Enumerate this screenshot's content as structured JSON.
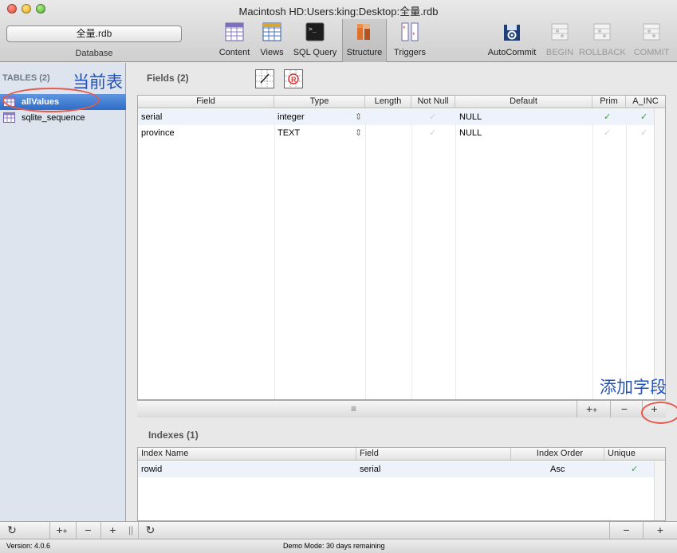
{
  "window": {
    "title": "Macintosh HD:Users:king:Desktop:全量.rdb"
  },
  "toolbar": {
    "database_value": "全量.rdb",
    "database_label": "Database",
    "buttons": [
      {
        "label": "Content",
        "icon": "content-icon"
      },
      {
        "label": "Views",
        "icon": "views-icon"
      },
      {
        "label": "SQL Query",
        "icon": "terminal-icon"
      },
      {
        "label": "Structure",
        "icon": "structure-icon",
        "selected": true
      },
      {
        "label": "Triggers",
        "icon": "triggers-icon"
      },
      {
        "label": "AutoCommit",
        "icon": "autocommit-icon"
      },
      {
        "label": "BEGIN",
        "icon": "begin-icon",
        "disabled": true
      },
      {
        "label": "ROLLBACK",
        "icon": "rollback-icon",
        "disabled": true
      },
      {
        "label": "COMMIT",
        "icon": "commit-icon",
        "disabled": true
      }
    ]
  },
  "sidebar": {
    "header": "TABLES (2)",
    "tables": [
      {
        "name": "allValues",
        "selected": true
      },
      {
        "name": "sqlite_sequence",
        "selected": false
      }
    ],
    "annotation": "当前表"
  },
  "fields": {
    "title": "Fields (2)",
    "columns": [
      "Field",
      "Type",
      "Length",
      "Not Null",
      "Default",
      "Prim",
      "A_INC"
    ],
    "rows": [
      {
        "field": "serial",
        "type": "integer",
        "length": "",
        "default": "NULL",
        "not_null": false,
        "prim": true,
        "ainc": true
      },
      {
        "field": "province",
        "type": "TEXT",
        "length": "",
        "default": "NULL",
        "not_null": false,
        "prim": false,
        "ainc": false
      }
    ],
    "add_annotation": "添加字段",
    "buttons": {
      "add": "+",
      "remove": "−",
      "duplicate": "+"
    }
  },
  "indexes": {
    "title": "Indexes (1)",
    "columns": [
      "Index Name",
      "Field",
      "Index Order",
      "Unique"
    ],
    "rows": [
      {
        "name": "rowid",
        "field": "serial",
        "order": "Asc",
        "unique": true
      }
    ]
  },
  "footer": {
    "version": "Version: 4.0.6",
    "demo": "Demo Mode: 30 days remaining",
    "refresh": "↻",
    "add": "+",
    "remove": "−"
  },
  "colors": {
    "selection": "#2d6cc8",
    "annotation": "#2452b8",
    "circle": "#e55a4a",
    "check": "#2ba52b"
  }
}
